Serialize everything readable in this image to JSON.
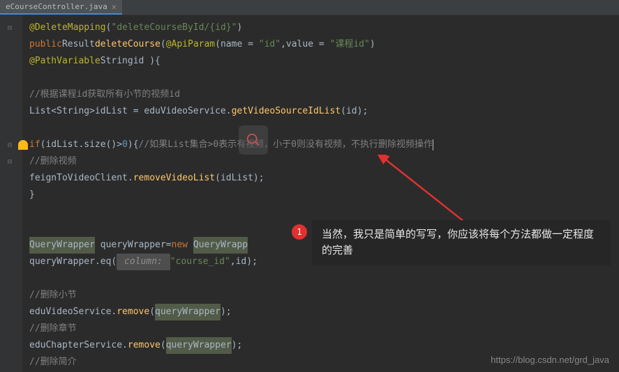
{
  "tab": {
    "filename": "eCourseController.java",
    "close": "×"
  },
  "code": {
    "l1_ann": "@DeleteMapping",
    "l1_str": "\"deleteCourseById/{id}\"",
    "l2_pub": "public",
    "l2_ret": "Result",
    "l2_name": "deleteCourse",
    "l2_ann": "@ApiParam",
    "l2_name_attr": "name = ",
    "l2_name_val": "\"id\"",
    "l2_val_attr": ",value = ",
    "l2_val_val": "\"课程id\"",
    "l3_ann": "@PathVariable",
    "l3_type": "String",
    "l3_param": "id ){",
    "l5_comment": "//根据课程id获取所有小节的视频id",
    "l6_type": "List<String>",
    "l6_var": "idList = eduVideoService.",
    "l6_method": "getVideoSourceIdList",
    "l6_arg": "(id);",
    "l8_if": "if",
    "l8_cond": "(idList.size()>",
    "l8_zero": "0",
    "l8_brace": "){",
    "l8_comment": "//如果List集合>0表示有视频，小于0则没有视频，不执行删除视频操作",
    "l9_comment": "//删除视频",
    "l10_call": "feignToVideoClient.",
    "l10_method": "removeVideoList",
    "l10_arg": "(idList);",
    "l11_brace": "}",
    "l14_type": "QueryWrapper",
    "l14_var": " queryWrapper=",
    "l14_new": "new ",
    "l14_ctor": "QueryWrapp",
    "l15_call": "queryWrapper.eq(",
    "l15_hint": " column: ",
    "l15_str": "\"course_id\"",
    "l15_rest": ",id);",
    "l17_comment": "//删除小节",
    "l18_svc": "eduVideoService.",
    "l18_method": "remove",
    "l18_arg1": "(",
    "l18_arg2": "queryWrapper",
    "l18_arg3": ");",
    "l19_comment": "//删除章节",
    "l20_svc": "eduChapterService.",
    "l20_method": "remove",
    "l20_arg1": "(",
    "l20_arg2": "queryWrapper",
    "l20_arg3": ");",
    "l21_comment": "//删除简介"
  },
  "callout": {
    "badge": "1",
    "text": "当然，我只是简单的写写，你应该将每个方法都做一定程度的完善"
  },
  "watermark": "https://blog.csdn.net/grd_java"
}
